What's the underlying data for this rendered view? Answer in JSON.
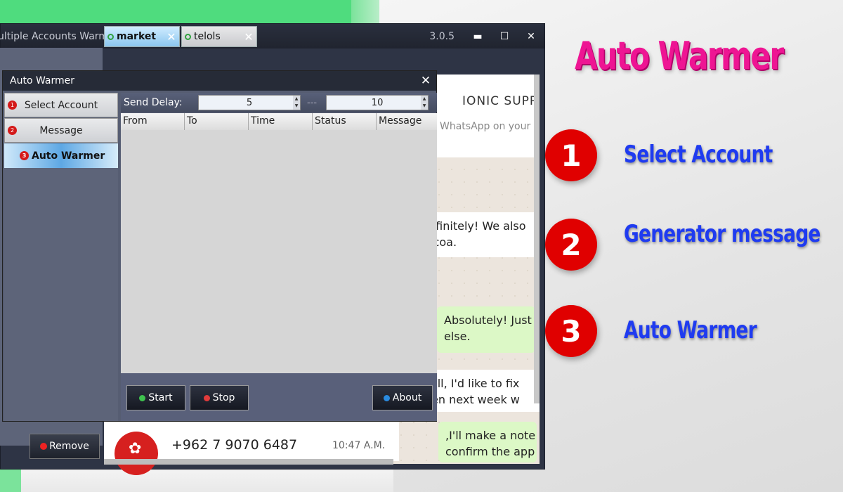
{
  "window": {
    "title": "ultiple Accounts Warm Pro",
    "version": "3.0.5",
    "minimize": "▬",
    "maximize": "☐",
    "close": "✕"
  },
  "tabs": [
    {
      "label": "market",
      "close": "✕"
    },
    {
      "label": "telols",
      "close": "✕"
    }
  ],
  "remove_button": "Remove",
  "chat": {
    "name": "IONIC SUPP",
    "sub": "WhatsApp on your",
    "messages": [
      "Definitely! We also\ncocoa.",
      "Absolutely! Just\nelse.",
      "Well, I'd like to fix\nreen next week w",
      ",I'll make a note\nconfirm the app"
    ],
    "contact": {
      "number": "+962 7 9070 6487",
      "time": "10:47 A.M."
    }
  },
  "dialog": {
    "title": "Auto Warmer",
    "close": "✕",
    "nav": [
      {
        "num": "1",
        "label": "Select Account"
      },
      {
        "num": "2",
        "label": "Message"
      },
      {
        "num": "3",
        "label": "Auto Warmer"
      }
    ],
    "send_delay_label": "Send Delay:",
    "delay_min": "5",
    "delay_sep": "---",
    "delay_max": "10",
    "columns": [
      "From",
      "To",
      "Time",
      "Status",
      "Message"
    ],
    "buttons": {
      "start": "Start",
      "stop": "Stop",
      "about": "About"
    }
  },
  "promo": {
    "headline": "Auto Warmer",
    "steps": [
      {
        "num": "1",
        "label": "Select Account"
      },
      {
        "num": "2",
        "label": "Generator message"
      },
      {
        "num": "3",
        "label": "Auto Warmer"
      }
    ]
  },
  "colors": {
    "accent_pink": "#ee1593",
    "step_blue": "#1f3bf0",
    "step_red": "#e00000",
    "green_indicator": "#31a13f"
  }
}
